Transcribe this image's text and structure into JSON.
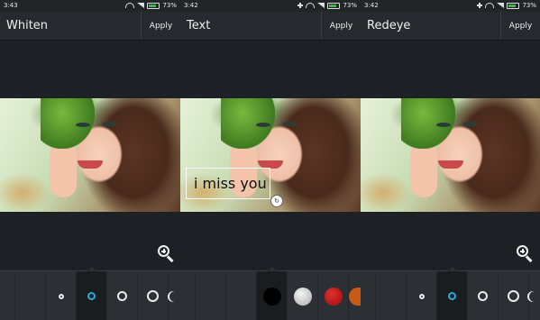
{
  "panels": [
    {
      "status": {
        "time": "3:43",
        "battery": "73%"
      },
      "title": "Whiten",
      "apply_label": "Apply"
    },
    {
      "status": {
        "time": "3:42",
        "battery": "73%"
      },
      "title": "Text",
      "apply_label": "Apply",
      "text_overlay": "i miss you"
    },
    {
      "status": {
        "time": "3:42",
        "battery": "73%"
      },
      "title": "Redeye",
      "apply_label": "Apply"
    }
  ],
  "brush_sizes": [
    "tiny",
    "small",
    "medium",
    "large",
    "xlarge"
  ],
  "color_swatches": [
    "#000000",
    "#cfcfcf",
    "#c41212",
    "#c85a16"
  ],
  "colors": {
    "accent": "#2aa9e0",
    "background": "#1d2126",
    "toolbar": "#2c3035"
  },
  "icons": [
    "zoom-in-icon",
    "rotate-resize-icon",
    "wifi-icon",
    "signal-icon",
    "battery-icon"
  ]
}
